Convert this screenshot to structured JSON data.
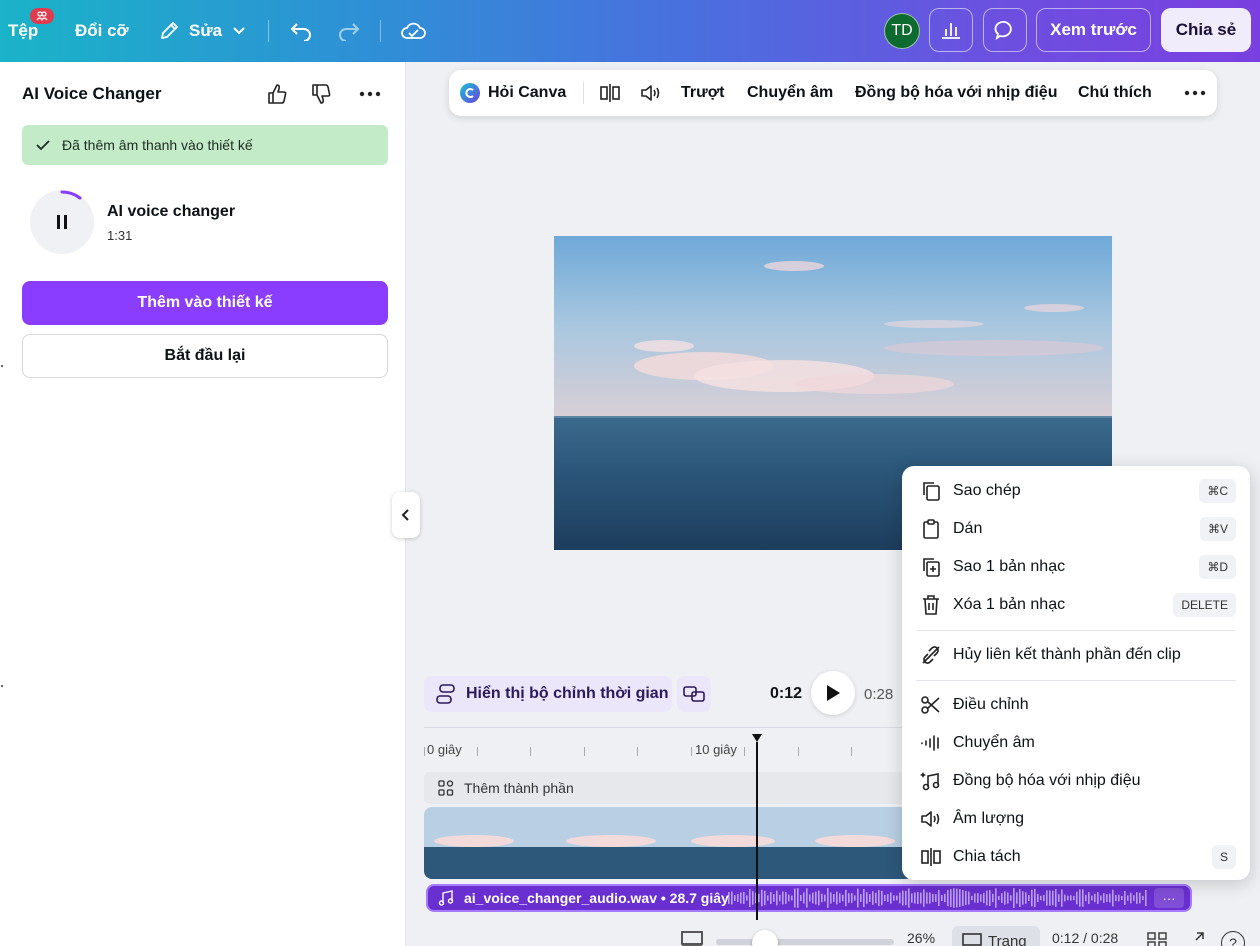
{
  "topbar": {
    "file": "Tệp",
    "file_badge": "",
    "resize": "Đổi cỡ",
    "edit": "Sửa",
    "avatar": "TD",
    "preview": "Xem trước",
    "share": "Chia sẻ"
  },
  "panel": {
    "title": "AI Voice Changer",
    "toast": "Đã thêm âm thanh vào thiết kế",
    "track_title": "AI voice changer",
    "track_duration": "1:31",
    "add_button": "Thêm vào thiết kế",
    "restart_button": "Bắt đầu lại"
  },
  "toolbar": {
    "ask_canva": "Hỏi Canva",
    "slide": "Trượt",
    "voice": "Chuyển âm",
    "sync": "Đồng bộ hóa với nhịp điệu",
    "caption": "Chú thích"
  },
  "timeline": {
    "show_timing": "Hiển thị bộ chỉnh thời gian",
    "current_time": "0:12",
    "total_time": "0:28",
    "ruler_0": "0 giây",
    "ruler_10": "10 giây",
    "add_element": "Thêm thành phần",
    "audio_label": "ai_voice_changer_audio.wav • 28.7 giây",
    "audio_more": "···"
  },
  "bottombar": {
    "zoom": "26%",
    "pages": "Trang",
    "time": "0:12 / 0:28",
    "help": "?"
  },
  "context_menu": {
    "items": [
      {
        "label": "Sao chép",
        "shortcut": "⌘C"
      },
      {
        "label": "Dán",
        "shortcut": "⌘V"
      },
      {
        "label": "Sao 1 bản nhạc",
        "shortcut": "⌘D"
      },
      {
        "label": "Xóa 1 bản nhạc",
        "shortcut": "DELETE"
      },
      {
        "label": "Hủy liên kết thành phần đến clip",
        "shortcut": ""
      },
      {
        "label": "Điều chỉnh",
        "shortcut": ""
      },
      {
        "label": "Chuyển âm",
        "shortcut": ""
      },
      {
        "label": "Đồng bộ hóa với nhịp điệu",
        "shortcut": ""
      },
      {
        "label": "Âm lượng",
        "shortcut": ""
      },
      {
        "label": "Chia tách",
        "shortcut": "S"
      }
    ]
  },
  "colors": {
    "accent_purple": "#8b3dff",
    "toast_green": "#c3ebc8",
    "audio_track": "#6a2fd0"
  }
}
